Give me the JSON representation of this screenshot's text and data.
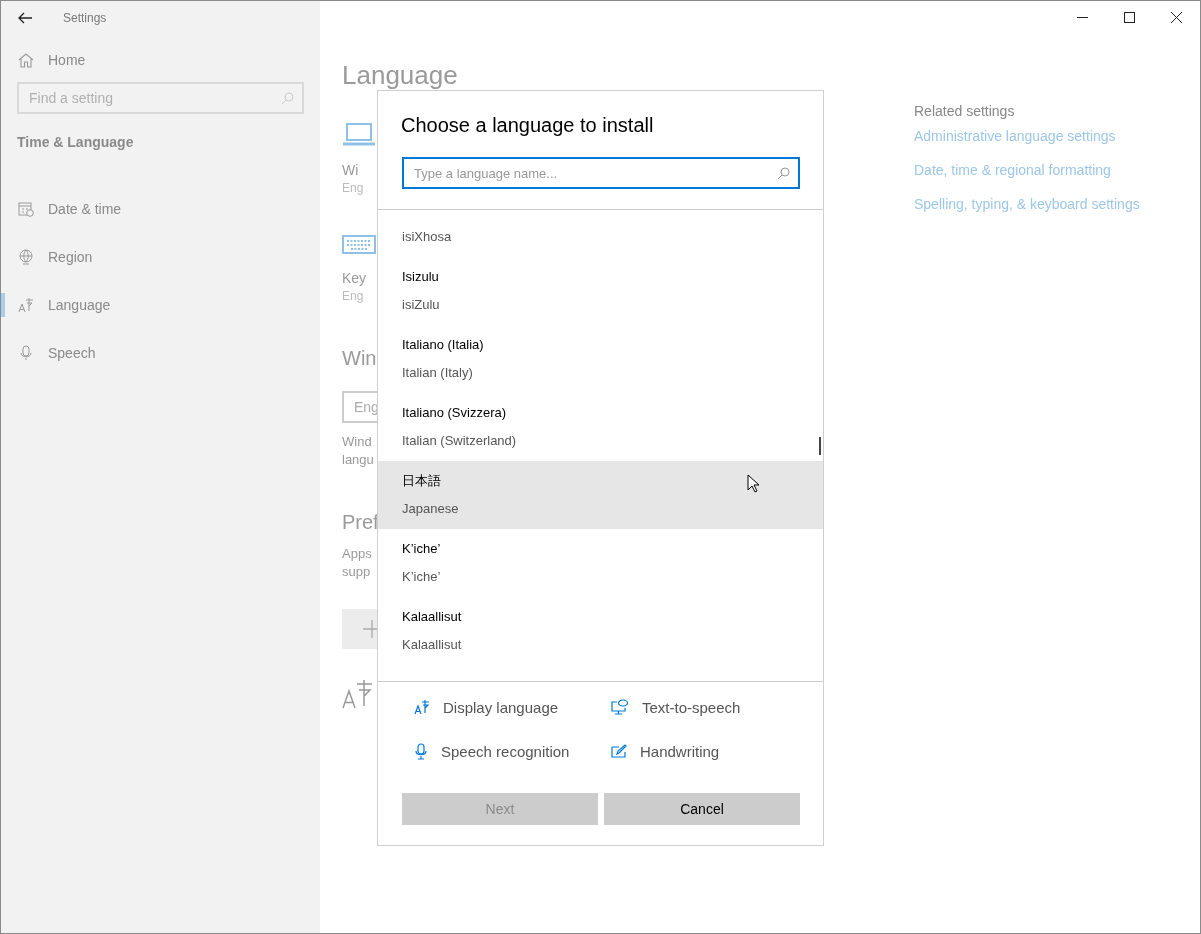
{
  "window": {
    "title": "Settings"
  },
  "sidebar": {
    "home": "Home",
    "search": {
      "placeholder": "Find a setting"
    },
    "section": "Time & Language",
    "items": [
      {
        "label": "Date & time",
        "selected": false
      },
      {
        "label": "Region",
        "selected": false
      },
      {
        "label": "Language",
        "selected": true
      },
      {
        "label": "Speech",
        "selected": false
      }
    ]
  },
  "page": {
    "title": "Language",
    "blocks": [
      {
        "kind": "tile",
        "title": "Wi",
        "subtitle": "Eng"
      },
      {
        "kind": "tile",
        "title": "Key",
        "subtitle": "Eng"
      },
      {
        "kind": "heading",
        "text": "Win"
      },
      {
        "kind": "field",
        "value": "Eng"
      },
      {
        "kind": "text",
        "lines": [
          "Wind",
          "langu"
        ]
      },
      {
        "kind": "heading",
        "text": "Pref"
      },
      {
        "kind": "text",
        "lines": [
          "Apps",
          "supp"
        ]
      },
      {
        "kind": "add"
      },
      {
        "kind": "glyph"
      }
    ]
  },
  "related": {
    "title": "Related settings",
    "links": [
      "Administrative language settings",
      "Date, time & regional formatting",
      "Spelling, typing, & keyboard settings"
    ]
  },
  "dialog": {
    "title": "Choose a language to install",
    "search": {
      "placeholder": "Type a language name..."
    },
    "languages": [
      {
        "english": "isiXhosa",
        "selected": false
      },
      {
        "name": "Isizulu",
        "english": "isiZulu",
        "selected": false
      },
      {
        "name": "Italiano (Italia)",
        "english": "Italian (Italy)",
        "selected": false
      },
      {
        "name": "Italiano (Svizzera)",
        "english": "Italian (Switzerland)",
        "selected": false
      },
      {
        "name": "日本語",
        "english": "Japanese",
        "selected": true
      },
      {
        "name": "K’iche’",
        "english": "K’iche’",
        "selected": false
      },
      {
        "name": "Kalaallisut",
        "english": "Kalaallisut",
        "selected": false
      }
    ],
    "features": [
      "Display language",
      "Text-to-speech",
      "Speech recognition",
      "Handwriting"
    ],
    "buttons": [
      {
        "label": "Next",
        "disabled": true
      },
      {
        "label": "Cancel",
        "disabled": false
      }
    ]
  }
}
